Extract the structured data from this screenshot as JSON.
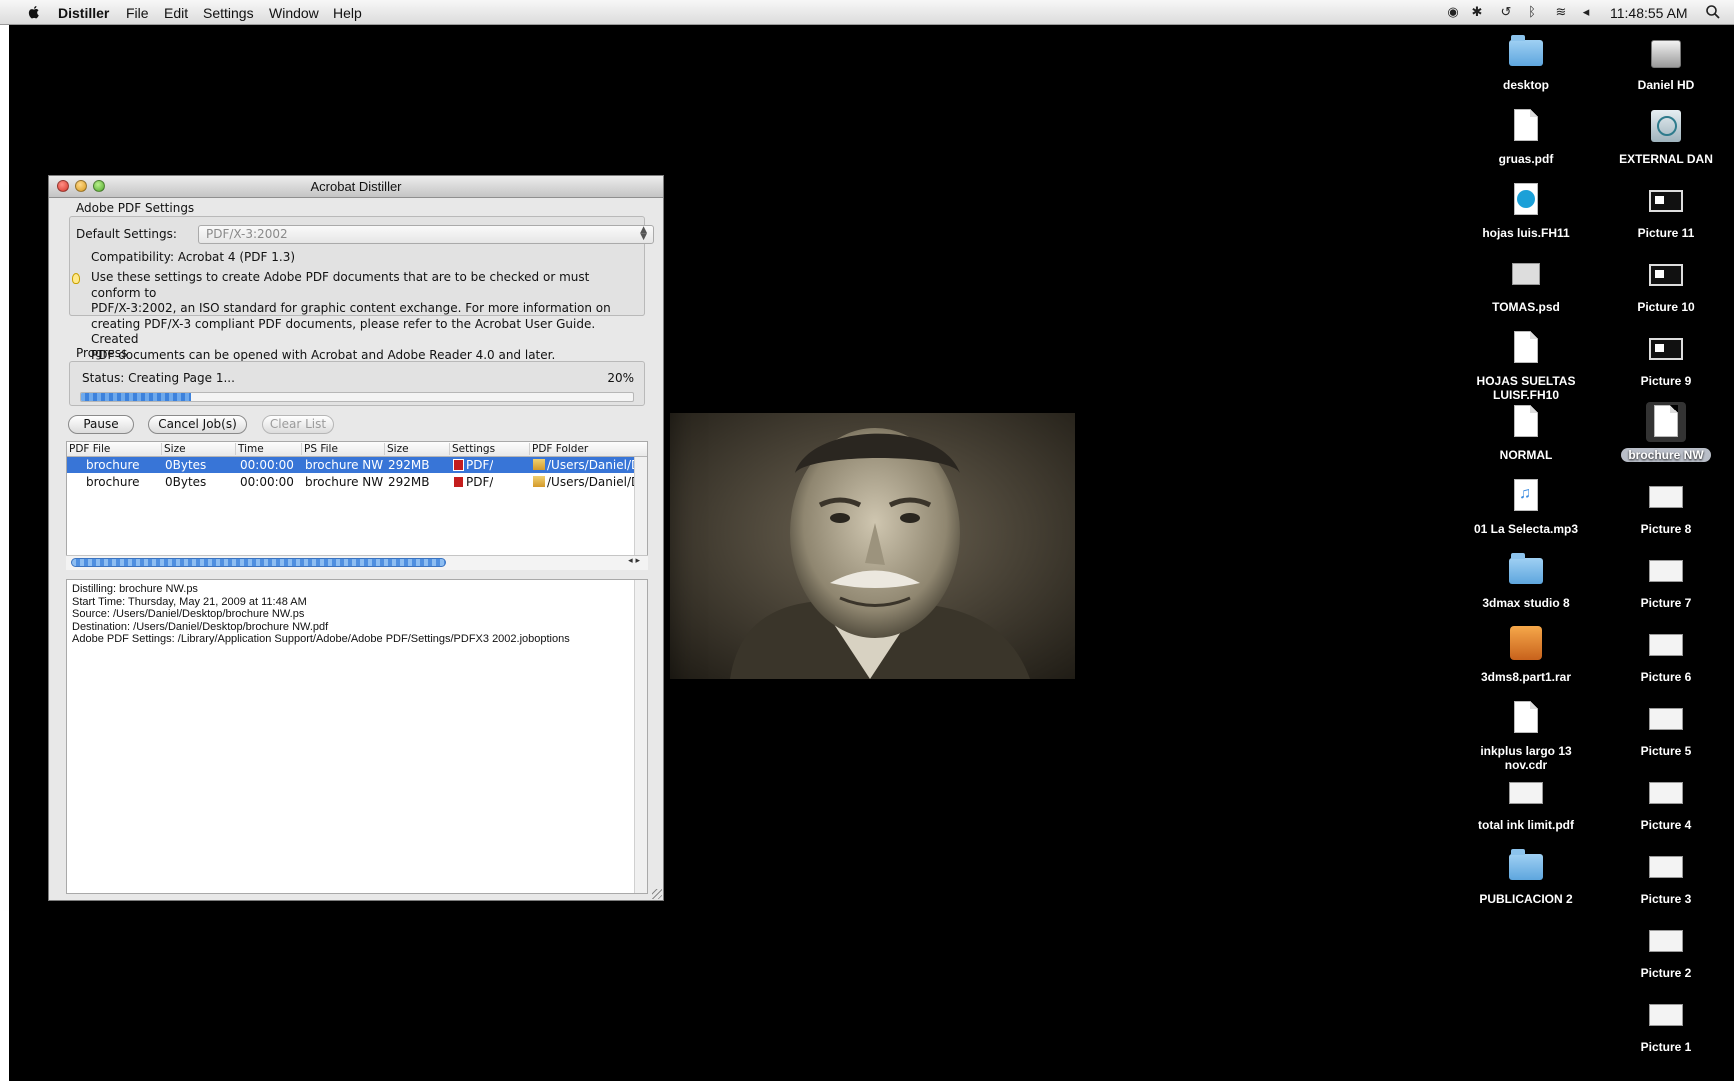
{
  "menubar": {
    "app_name": "Distiller",
    "menus": [
      "File",
      "Edit",
      "Settings",
      "Window",
      "Help"
    ],
    "clock": "11:48:55 AM"
  },
  "desktop_icons": [
    {
      "label": "desktop",
      "icon": "folder-icon"
    },
    {
      "label": "Daniel HD",
      "icon": "hard-drive-icon"
    },
    {
      "label": "gruas.pdf",
      "icon": "pdf-document-icon"
    },
    {
      "label": "EXTERNAL DAN",
      "icon": "time-machine-drive-icon"
    },
    {
      "label": "hojas luis.FH11",
      "icon": "freehand-document-icon"
    },
    {
      "label": "Picture 11",
      "icon": "screenshot-icon"
    },
    {
      "label": "TOMAS.psd",
      "icon": "psd-document-icon"
    },
    {
      "label": "Picture 10",
      "icon": "screenshot-icon"
    },
    {
      "label": "HOJAS SUELTAS LUISF.FH10",
      "icon": "document-icon"
    },
    {
      "label": "Picture 9",
      "icon": "screenshot-icon"
    },
    {
      "label": "NORMAL",
      "icon": "document-icon"
    },
    {
      "label": "brochure NW",
      "icon": "postscript-document-icon"
    },
    {
      "label": "01 La Selecta.mp3",
      "icon": "mp3-document-icon"
    },
    {
      "label": "Picture 8",
      "icon": "screenshot-icon"
    },
    {
      "label": "3dmax studio 8",
      "icon": "folder-icon"
    },
    {
      "label": "Picture 7",
      "icon": "screenshot-icon"
    },
    {
      "label": "3dms8.part1.rar",
      "icon": "rar-archive-icon"
    },
    {
      "label": "Picture 6",
      "icon": "screenshot-icon"
    },
    {
      "label": "inkplus largo 13 nov.cdr",
      "icon": "document-icon"
    },
    {
      "label": "Picture 5",
      "icon": "screenshot-icon"
    },
    {
      "label": "total ink limit.pdf",
      "icon": "pdf-document-icon"
    },
    {
      "label": "Picture 4",
      "icon": "screenshot-icon"
    },
    {
      "label": "PUBLICACION 2",
      "icon": "folder-icon"
    },
    {
      "label": "Picture 3",
      "icon": "screenshot-icon"
    },
    {
      "label": "Picture 2",
      "icon": "screenshot-icon"
    },
    {
      "label": "Picture 1",
      "icon": "screenshot-icon"
    }
  ],
  "window": {
    "title": "Acrobat Distiller",
    "pdf_settings_header": "Adobe PDF Settings",
    "default_settings_label": "Default Settings:",
    "default_settings_value": "PDF/X-3:2002",
    "compatibility": "Compatibility:  Acrobat 4 (PDF 1.3)",
    "description_lines": [
      "Use these settings to create Adobe PDF documents that are to be checked or must conform to",
      "PDF/X-3:2002, an ISO standard for graphic content exchange.  For more information on",
      "creating PDF/X-3 compliant PDF documents, please refer to the Acrobat User Guide.  Created",
      "PDF documents can be opened with Acrobat and Adobe Reader 4.0 and later."
    ],
    "progress_header": "Progress",
    "status": "Status:  Creating Page 1...",
    "percent_text": "20%",
    "progress_fraction": 0.2,
    "buttons": {
      "pause": "Pause",
      "cancel": "Cancel Job(s)",
      "clear": "Clear List"
    },
    "columns": [
      "PDF File",
      "Size",
      "Time",
      "PS File",
      "Size",
      "Settings",
      "PDF Folder"
    ],
    "rows": [
      {
        "pdf_file": "brochure",
        "size": "0Bytes",
        "time": "00:00:00",
        "ps_file": "brochure NW.",
        "ps_size": "292MB",
        "settings": "PDF/",
        "folder": "/Users/Daniel/D"
      },
      {
        "pdf_file": "brochure",
        "size": "0Bytes",
        "time": "00:00:00",
        "ps_file": "brochure NW.",
        "ps_size": "292MB",
        "settings": "PDF/",
        "folder": "/Users/Daniel/D"
      }
    ],
    "log_lines": [
      "Distilling: brochure NW.ps",
      "Start Time: Thursday, May 21, 2009 at 11:48 AM",
      "Source: /Users/Daniel/Desktop/brochure NW.ps",
      "Destination: /Users/Daniel/Desktop/brochure NW.pdf",
      "Adobe PDF Settings: /Library/Application Support/Adobe/Adobe PDF/Settings/PDFX3 2002.joboptions"
    ]
  }
}
